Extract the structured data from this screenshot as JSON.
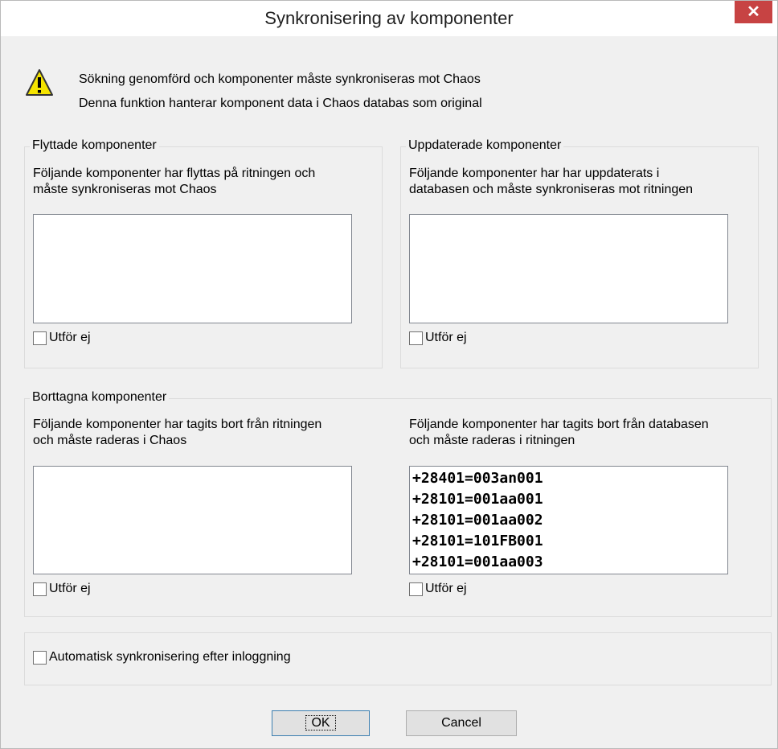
{
  "window": {
    "title": "Synkronisering av komponenter",
    "close_glyph": "✕"
  },
  "message": {
    "line1": "Sökning genomförd och komponenter måste synkroniseras mot Chaos",
    "line2": "Denna funktion hanterar komponent data i Chaos databas som original",
    "icon": "warning-icon"
  },
  "moved": {
    "legend": "Flyttade komponenter",
    "desc_line1": "Följande komponenter har flyttas på ritningen och",
    "desc_line2": "måste synkroniseras mot Chaos",
    "items": [],
    "checkbox_label": "Utför ej",
    "checked": false
  },
  "updated": {
    "legend": "Uppdaterade komponenter",
    "desc_line1": "Följande komponenter har har uppdaterats i",
    "desc_line2": "databasen och måste synkroniseras mot ritningen",
    "items": [],
    "checkbox_label": "Utför ej",
    "checked": false
  },
  "removed": {
    "legend": "Borttagna komponenter",
    "left": {
      "desc_line1": "Följande komponenter har tagits bort från ritningen",
      "desc_line2": "och måste raderas i Chaos",
      "items": [],
      "checkbox_label": "Utför ej",
      "checked": false
    },
    "right": {
      "desc_line1": "Följande komponenter har tagits bort från databasen",
      "desc_line2": "och måste raderas i ritningen",
      "items": [
        "+28401=003an001",
        "+28101=001aa001",
        "+28101=001aa002",
        "+28101=101FB001",
        "+28101=001aa003"
      ],
      "checkbox_label": "Utför ej",
      "checked": false
    }
  },
  "auto_sync": {
    "label": "Automatisk synkronisering efter inloggning",
    "checked": false
  },
  "buttons": {
    "ok": "OK",
    "cancel": "Cancel"
  },
  "colors": {
    "close_bg": "#c74343",
    "window_bg": "#f0f0f0",
    "warning_yellow": "#f5e400"
  }
}
